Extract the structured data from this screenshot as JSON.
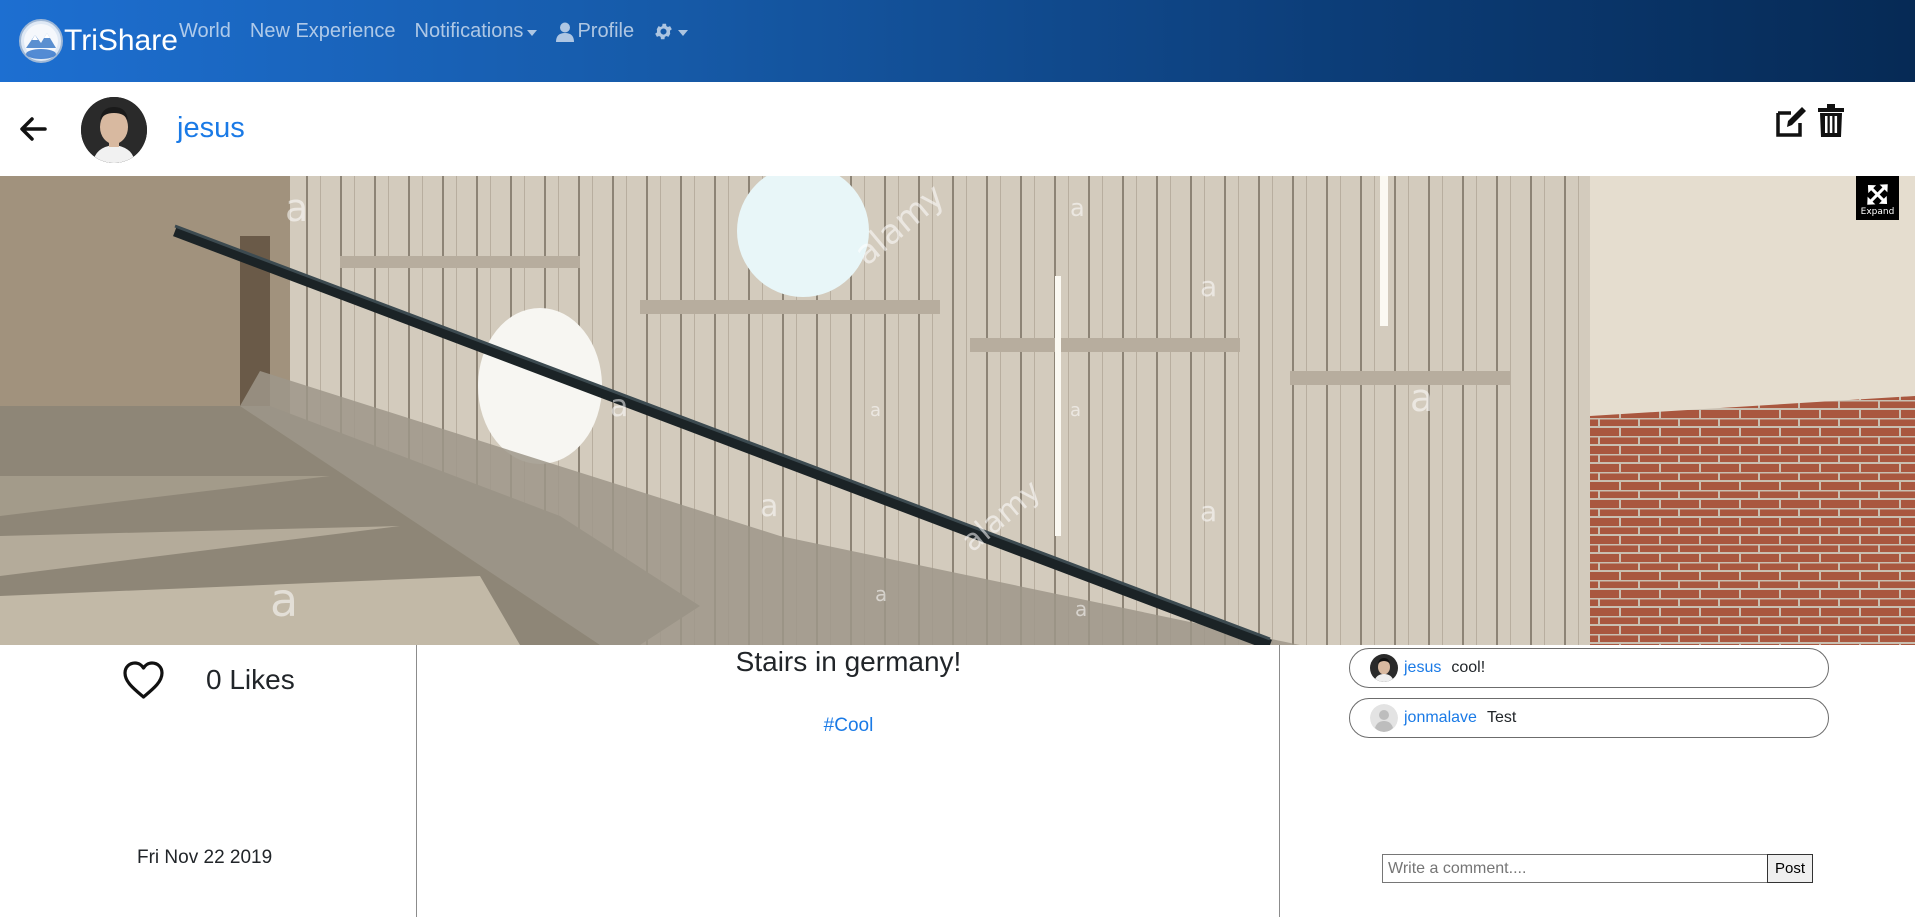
{
  "navbar": {
    "brand": "TriShare",
    "links": {
      "world": "World",
      "new_experience": "New Experience",
      "notifications": "Notifications",
      "profile": "Profile"
    },
    "icons": [
      "globe-logo",
      "user-icon",
      "gear-icon",
      "caret-down-icon"
    ],
    "gradient": [
      "#1d6fd1",
      "#062a55"
    ]
  },
  "post": {
    "author": "jesus",
    "title": "Stairs in germany!",
    "tag": "#Cool",
    "likes_label": "0 Likes",
    "likes_count": 0,
    "date": "Fri Nov 22 2019",
    "expand_label": "Expand",
    "watermark": "alamy"
  },
  "comments": [
    {
      "user": "jesus",
      "text": "cool!"
    },
    {
      "user": "jonmalave",
      "text": "Test"
    }
  ],
  "comment_form": {
    "placeholder": "Write a comment....",
    "value": "",
    "submit_label": "Post"
  },
  "colors": {
    "link": "#1a7ae6",
    "text": "#212529"
  }
}
